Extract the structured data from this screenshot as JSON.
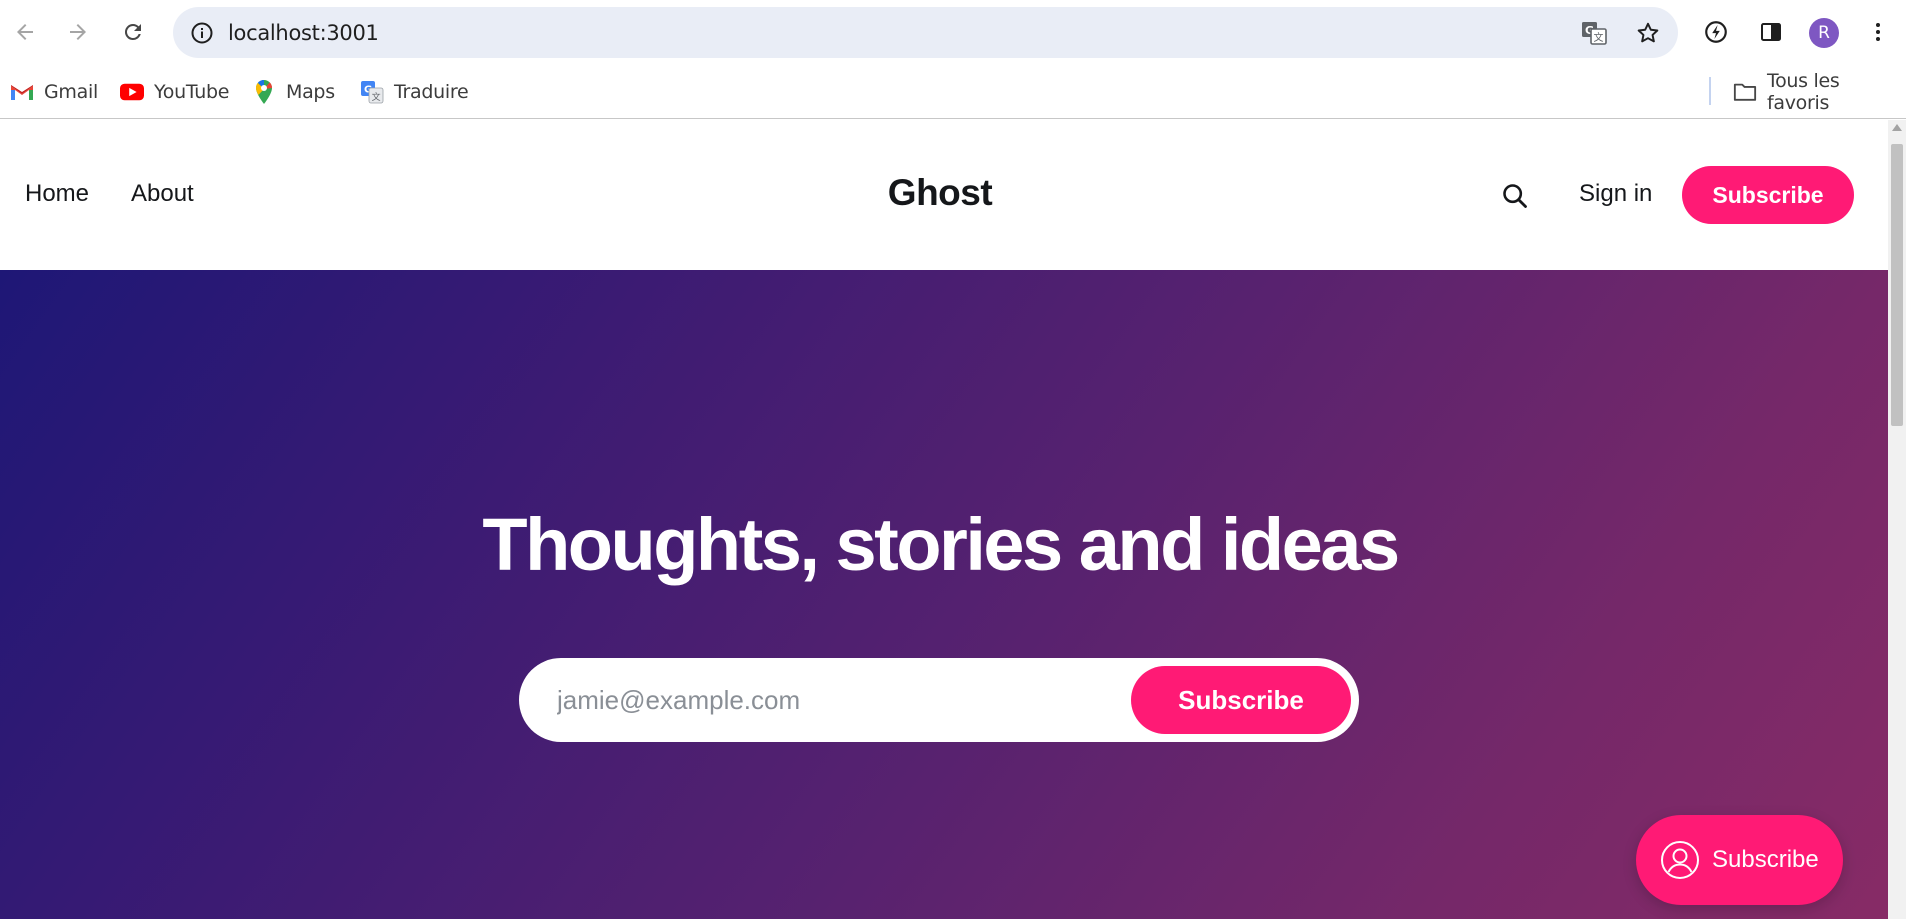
{
  "browser": {
    "url": "localhost:3001",
    "profile_initial": "R",
    "bookmarks": [
      {
        "label": "Gmail",
        "icon": "gmail-icon"
      },
      {
        "label": "YouTube",
        "icon": "youtube-icon"
      },
      {
        "label": "Maps",
        "icon": "maps-icon"
      },
      {
        "label": "Traduire",
        "icon": "translate-icon"
      }
    ],
    "all_bookmarks_label": "Tous les favoris"
  },
  "site": {
    "title": "Ghost",
    "nav": [
      {
        "label": "Home"
      },
      {
        "label": "About"
      }
    ],
    "sign_in_label": "Sign in",
    "subscribe_label": "Subscribe",
    "accent_color": "#ff1a75"
  },
  "hero": {
    "title": "Thoughts, stories and ideas",
    "email_placeholder": "jamie@example.com",
    "subscribe_label": "Subscribe"
  },
  "portal": {
    "label": "Subscribe",
    "icon": "user-circle-icon"
  }
}
